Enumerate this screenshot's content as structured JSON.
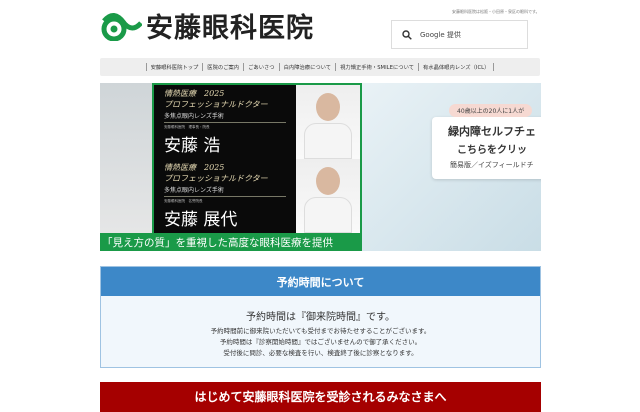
{
  "header": {
    "logo_text": "安藤眼科医院",
    "tagline": "安藤眼科医院は松阪・小田原・泉区の眼科です。",
    "search_placeholder": "Google 提供"
  },
  "nav": [
    "安藤眼科医院トップ",
    "医院のご案内",
    "ごあいさつ",
    "白内障治療について",
    "視力矯正手術・SMILEについて",
    "有水晶体眼内レンズ（ICL）"
  ],
  "banner": {
    "cards": [
      {
        "line1": "情熱医療　2025",
        "line2": "プロフェッショナルドクター",
        "line3": "多焦点眼内レンズ手術",
        "role": "安藤眼科医院　理事長・院長",
        "name": "安藤 浩"
      },
      {
        "line1": "情熱医療　2025",
        "line2": "プロフェッショナルドクター",
        "line3": "多焦点眼内レンズ手術",
        "role": "安藤眼科医院　名誉院長",
        "name": "安藤 展代"
      }
    ],
    "caption": "「見え方の質」を重視した高度な眼科医療を提供",
    "side_pill": "40歳以上の20人に1人が",
    "side_title1": "緑内障セルフチェ",
    "side_title2": "こちらをクリッ",
    "side_note": "簡易版／イズフィールドチ"
  },
  "info": {
    "title": "予約時間について",
    "main": "予約時間は『御来院時間』です。",
    "lines": [
      "予約時間前に御来院いただいても受付までお待たせすることがございます。",
      "予約時間は『診察開始時間』ではございませんので御了承ください。",
      "受付後に問診、必要な検査を行い、検査終了後に診察となります。"
    ]
  },
  "notice": {
    "title": "はじめて安藤眼科医院を受診されるみなさまへ"
  }
}
